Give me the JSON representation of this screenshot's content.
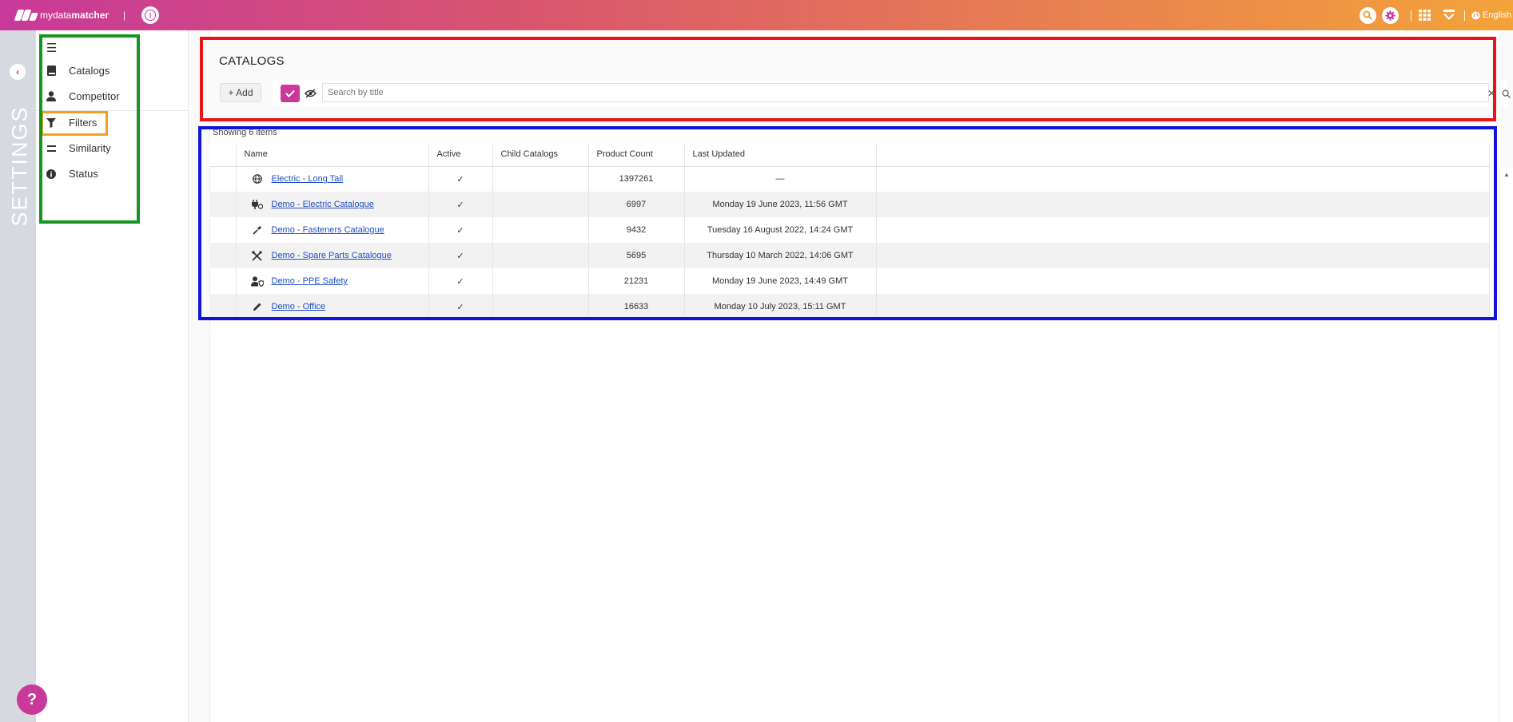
{
  "app": {
    "logo_prefix": "mydata",
    "logo_bold": "matcher",
    "separator": "|",
    "language": "English"
  },
  "rail": {
    "label": "SETTINGS",
    "back_icon": "chevron-left-icon",
    "help": "?"
  },
  "nav": {
    "items": [
      {
        "label": "Catalogs",
        "icon": "book-icon"
      },
      {
        "label": "Competitor",
        "icon": "person-icon"
      },
      {
        "label": "Filters",
        "icon": "filter-icon"
      },
      {
        "label": "Similarity",
        "icon": "equals-icon"
      },
      {
        "label": "Status",
        "icon": "info-icon"
      }
    ]
  },
  "page": {
    "title": "CATALOGS",
    "add_label": "+ Add",
    "search_placeholder": "Search by title",
    "search_clear": "✕",
    "showing": "Showing 6 items"
  },
  "table": {
    "columns": [
      "Name",
      "Active",
      "Child Catalogs",
      "Product Count",
      "Last Updated"
    ],
    "rows": [
      {
        "icon": "globe-icon",
        "name": "Electric - Long Tail",
        "active": "✓",
        "child": "",
        "count": "1397261",
        "updated": "—"
      },
      {
        "icon": "plug-icon",
        "name": "Demo - Electric Catalogue",
        "active": "✓",
        "child": "",
        "count": "6997",
        "updated": "Monday 19 June 2023, 11:56 GMT"
      },
      {
        "icon": "screwdriver-icon",
        "name": "Demo - Fasteners Catalogue",
        "active": "✓",
        "child": "",
        "count": "9432",
        "updated": "Tuesday 16 August 2022, 14:24 GMT"
      },
      {
        "icon": "tools-icon",
        "name": "Demo - Spare Parts Catalogue",
        "active": "✓",
        "child": "",
        "count": "5695",
        "updated": "Thursday 10 March 2022, 14:06 GMT"
      },
      {
        "icon": "user-shield-icon",
        "name": "Demo - PPE Safety",
        "active": "✓",
        "child": "",
        "count": "21231",
        "updated": "Monday 19 June 2023, 14:49 GMT"
      },
      {
        "icon": "pencil-icon",
        "name": "Demo - Office",
        "active": "✓",
        "child": "",
        "count": "16633",
        "updated": "Monday 10 July 2023, 15:11 GMT"
      }
    ]
  },
  "colors": {
    "brand": "#c8399a",
    "link": "#1f4fc2",
    "annotation_red": "#e8141a",
    "annotation_blue": "#1212e0",
    "annotation_green": "#13961f",
    "annotation_orange": "#f2a01d"
  }
}
